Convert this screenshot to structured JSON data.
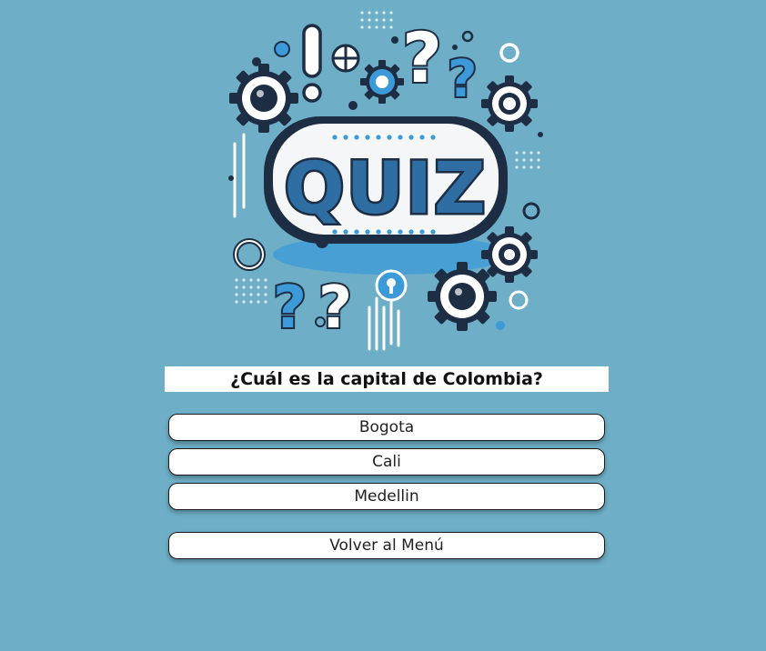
{
  "quiz": {
    "logo_text": "QUIZ",
    "question": "¿Cuál es la capital de Colombia?",
    "options": [
      {
        "label": "Bogota"
      },
      {
        "label": "Cali"
      },
      {
        "label": "Medellin"
      }
    ],
    "back_label": "Volver al Menú"
  },
  "colors": {
    "background": "#6eaec7",
    "logo_dark": "#1d2e44",
    "logo_blue": "#3c9ad8",
    "card": "#ffffff"
  }
}
